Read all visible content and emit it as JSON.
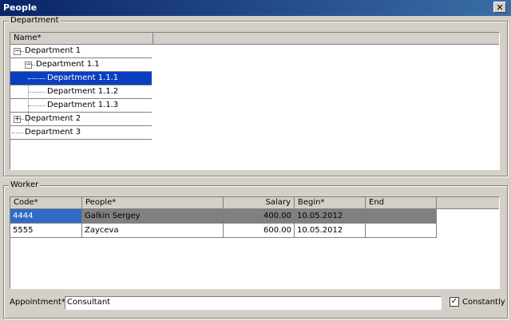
{
  "window": {
    "title": "People"
  },
  "department": {
    "group_label": "Department",
    "column_header": "Name*",
    "tree": [
      {
        "label": "Department 1",
        "expander": "−"
      },
      {
        "label": "Department 1.1",
        "expander": "−"
      },
      {
        "label": "Department 1.1.1",
        "selected": true
      },
      {
        "label": "Department 1.1.2"
      },
      {
        "label": "Department 1.1.3"
      },
      {
        "label": "Department 2",
        "expander": "+"
      },
      {
        "label": "Department 3"
      }
    ]
  },
  "worker": {
    "group_label": "Worker",
    "columns": [
      "Code*",
      "People*",
      "Salary",
      "Begin*",
      "End"
    ],
    "rows": [
      {
        "code": "4444",
        "people": "Galkin Sergey",
        "salary": "400.00",
        "begin": "10.05.2012",
        "end": ""
      },
      {
        "code": "5555",
        "people": "Zayceva",
        "salary": "600.00",
        "begin": "10.05.2012",
        "end": ""
      }
    ]
  },
  "appointment": {
    "label": "Appointment*",
    "value": "Consultant"
  },
  "constantly": {
    "label": "Constantly",
    "checked": "✓"
  },
  "icons": {
    "close": "✕"
  }
}
